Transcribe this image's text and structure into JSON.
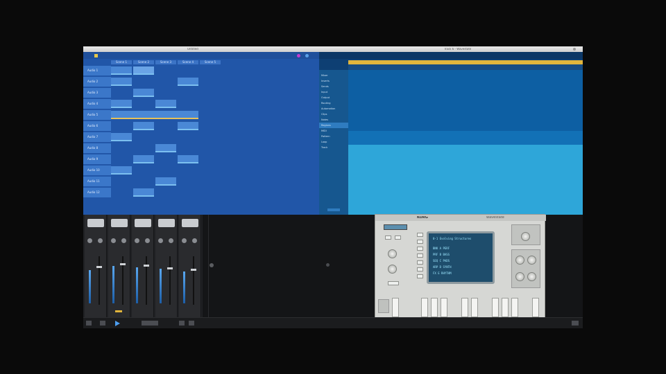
{
  "window": {
    "left_title": "Untitled",
    "right_title": "Track 6 - Wavestate"
  },
  "session": {
    "columns": [
      "Scene 1",
      "Scene 2",
      "Scene 3",
      "Scene 4",
      "Scene 5"
    ],
    "tracks": [
      "Audio 1",
      "Audio 2",
      "Audio 3",
      "Audio 4",
      "Audio 5",
      "Audio 6",
      "Audio 7",
      "Audio 8",
      "Audio 9",
      "Audio 10",
      "Audio 11",
      "Audio 12"
    ]
  },
  "timeline": {
    "sidebar": [
      "Mixer",
      "Inserts",
      "Sends",
      "Input",
      "Output",
      "Routing",
      "Automation",
      "Clips",
      "Notes",
      "Regions",
      "MIDI",
      "Pattern",
      "Loop",
      "Track"
    ],
    "selected_index": 9
  },
  "synth": {
    "brand": "KORG",
    "model": "wavestate",
    "presets": [
      "0-1 Evolving Structures",
      "BNK A  PERF",
      "PRF B  BASS",
      "SEQ C  PADS",
      "ARP D  SYNTH",
      "FX E  RHYTHM"
    ]
  },
  "colors": {
    "session_bg": "#2156a8",
    "timeline_bg": "#0e3f73",
    "accent": "#e2b53c",
    "synth_screen": "#1e4d6c"
  }
}
